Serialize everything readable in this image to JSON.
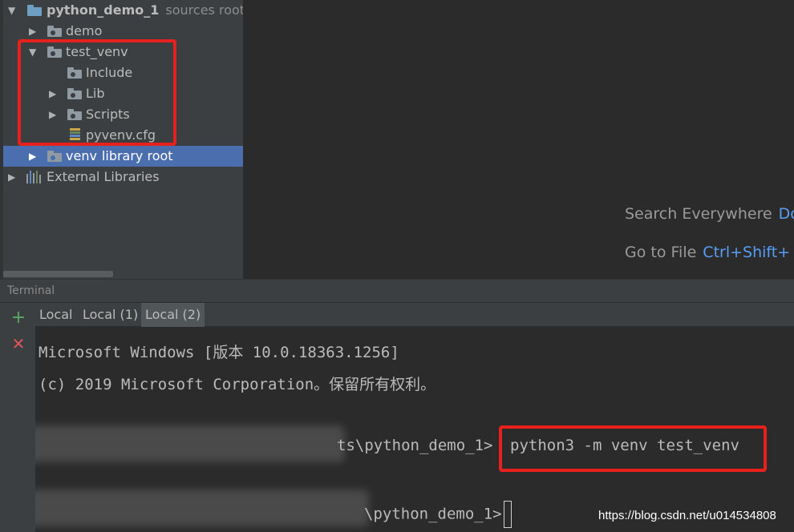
{
  "project_tree": {
    "root": {
      "name": "python_demo_1",
      "hint": "sources root, I"
    },
    "items": [
      {
        "label": "demo"
      },
      {
        "label": "test_venv"
      },
      {
        "label": "Include"
      },
      {
        "label": "Lib"
      },
      {
        "label": "Scripts"
      },
      {
        "label": "pyvenv.cfg"
      },
      {
        "label": "venv",
        "hint": "library root"
      },
      {
        "label": "External Libraries"
      }
    ]
  },
  "editor": {
    "hints": [
      {
        "action": "Search Everywhere",
        "shortcut": "Do"
      },
      {
        "action": "Go to File",
        "shortcut": "Ctrl+Shift+"
      }
    ]
  },
  "terminal": {
    "title": "Terminal",
    "tabs": [
      "Local",
      "Local (1)",
      "Local (2)"
    ],
    "active_tab": "Local (2)",
    "lines": [
      "Microsoft Windows [版本 10.0.18363.1256]",
      "(c) 2019 Microsoft Corporation。保留所有权利。",
      "ts\\python_demo_1>",
      "python3 -m venv test_venv",
      "\\python_demo_1>"
    ]
  },
  "watermark": "https://blog.csdn.net/u014534808",
  "colors": {
    "selection": "#4b6eaf",
    "highlight_box": "#e8211c",
    "shortcut": "#589df6",
    "add_button": "#59a869",
    "close_button": "#e05555"
  }
}
